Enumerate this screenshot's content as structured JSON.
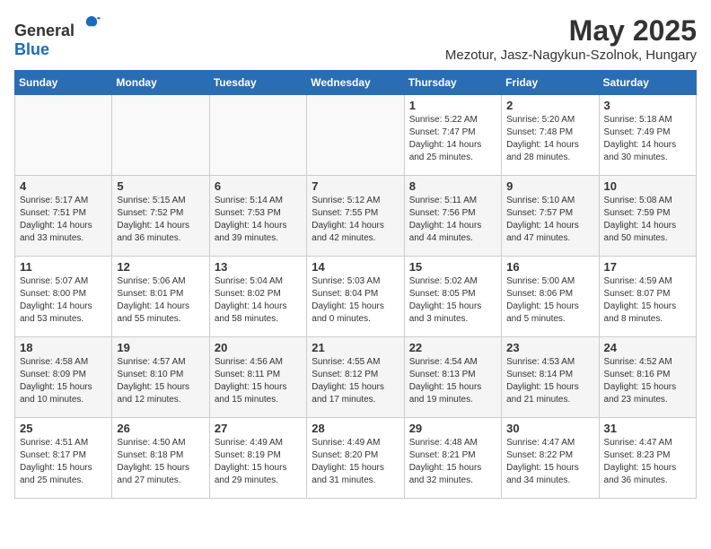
{
  "header": {
    "logo_general": "General",
    "logo_blue": "Blue",
    "month": "May 2025",
    "location": "Mezotur, Jasz-Nagykun-Szolnok, Hungary"
  },
  "days_of_week": [
    "Sunday",
    "Monday",
    "Tuesday",
    "Wednesday",
    "Thursday",
    "Friday",
    "Saturday"
  ],
  "weeks": [
    {
      "days": [
        {
          "num": "",
          "content": ""
        },
        {
          "num": "",
          "content": ""
        },
        {
          "num": "",
          "content": ""
        },
        {
          "num": "",
          "content": ""
        },
        {
          "num": "1",
          "content": "Sunrise: 5:22 AM\nSunset: 7:47 PM\nDaylight: 14 hours\nand 25 minutes."
        },
        {
          "num": "2",
          "content": "Sunrise: 5:20 AM\nSunset: 7:48 PM\nDaylight: 14 hours\nand 28 minutes."
        },
        {
          "num": "3",
          "content": "Sunrise: 5:18 AM\nSunset: 7:49 PM\nDaylight: 14 hours\nand 30 minutes."
        }
      ]
    },
    {
      "days": [
        {
          "num": "4",
          "content": "Sunrise: 5:17 AM\nSunset: 7:51 PM\nDaylight: 14 hours\nand 33 minutes."
        },
        {
          "num": "5",
          "content": "Sunrise: 5:15 AM\nSunset: 7:52 PM\nDaylight: 14 hours\nand 36 minutes."
        },
        {
          "num": "6",
          "content": "Sunrise: 5:14 AM\nSunset: 7:53 PM\nDaylight: 14 hours\nand 39 minutes."
        },
        {
          "num": "7",
          "content": "Sunrise: 5:12 AM\nSunset: 7:55 PM\nDaylight: 14 hours\nand 42 minutes."
        },
        {
          "num": "8",
          "content": "Sunrise: 5:11 AM\nSunset: 7:56 PM\nDaylight: 14 hours\nand 44 minutes."
        },
        {
          "num": "9",
          "content": "Sunrise: 5:10 AM\nSunset: 7:57 PM\nDaylight: 14 hours\nand 47 minutes."
        },
        {
          "num": "10",
          "content": "Sunrise: 5:08 AM\nSunset: 7:59 PM\nDaylight: 14 hours\nand 50 minutes."
        }
      ]
    },
    {
      "days": [
        {
          "num": "11",
          "content": "Sunrise: 5:07 AM\nSunset: 8:00 PM\nDaylight: 14 hours\nand 53 minutes."
        },
        {
          "num": "12",
          "content": "Sunrise: 5:06 AM\nSunset: 8:01 PM\nDaylight: 14 hours\nand 55 minutes."
        },
        {
          "num": "13",
          "content": "Sunrise: 5:04 AM\nSunset: 8:02 PM\nDaylight: 14 hours\nand 58 minutes."
        },
        {
          "num": "14",
          "content": "Sunrise: 5:03 AM\nSunset: 8:04 PM\nDaylight: 15 hours\nand 0 minutes."
        },
        {
          "num": "15",
          "content": "Sunrise: 5:02 AM\nSunset: 8:05 PM\nDaylight: 15 hours\nand 3 minutes."
        },
        {
          "num": "16",
          "content": "Sunrise: 5:00 AM\nSunset: 8:06 PM\nDaylight: 15 hours\nand 5 minutes."
        },
        {
          "num": "17",
          "content": "Sunrise: 4:59 AM\nSunset: 8:07 PM\nDaylight: 15 hours\nand 8 minutes."
        }
      ]
    },
    {
      "days": [
        {
          "num": "18",
          "content": "Sunrise: 4:58 AM\nSunset: 8:09 PM\nDaylight: 15 hours\nand 10 minutes."
        },
        {
          "num": "19",
          "content": "Sunrise: 4:57 AM\nSunset: 8:10 PM\nDaylight: 15 hours\nand 12 minutes."
        },
        {
          "num": "20",
          "content": "Sunrise: 4:56 AM\nSunset: 8:11 PM\nDaylight: 15 hours\nand 15 minutes."
        },
        {
          "num": "21",
          "content": "Sunrise: 4:55 AM\nSunset: 8:12 PM\nDaylight: 15 hours\nand 17 minutes."
        },
        {
          "num": "22",
          "content": "Sunrise: 4:54 AM\nSunset: 8:13 PM\nDaylight: 15 hours\nand 19 minutes."
        },
        {
          "num": "23",
          "content": "Sunrise: 4:53 AM\nSunset: 8:14 PM\nDaylight: 15 hours\nand 21 minutes."
        },
        {
          "num": "24",
          "content": "Sunrise: 4:52 AM\nSunset: 8:16 PM\nDaylight: 15 hours\nand 23 minutes."
        }
      ]
    },
    {
      "days": [
        {
          "num": "25",
          "content": "Sunrise: 4:51 AM\nSunset: 8:17 PM\nDaylight: 15 hours\nand 25 minutes."
        },
        {
          "num": "26",
          "content": "Sunrise: 4:50 AM\nSunset: 8:18 PM\nDaylight: 15 hours\nand 27 minutes."
        },
        {
          "num": "27",
          "content": "Sunrise: 4:49 AM\nSunset: 8:19 PM\nDaylight: 15 hours\nand 29 minutes."
        },
        {
          "num": "28",
          "content": "Sunrise: 4:49 AM\nSunset: 8:20 PM\nDaylight: 15 hours\nand 31 minutes."
        },
        {
          "num": "29",
          "content": "Sunrise: 4:48 AM\nSunset: 8:21 PM\nDaylight: 15 hours\nand 32 minutes."
        },
        {
          "num": "30",
          "content": "Sunrise: 4:47 AM\nSunset: 8:22 PM\nDaylight: 15 hours\nand 34 minutes."
        },
        {
          "num": "31",
          "content": "Sunrise: 4:47 AM\nSunset: 8:23 PM\nDaylight: 15 hours\nand 36 minutes."
        }
      ]
    }
  ]
}
